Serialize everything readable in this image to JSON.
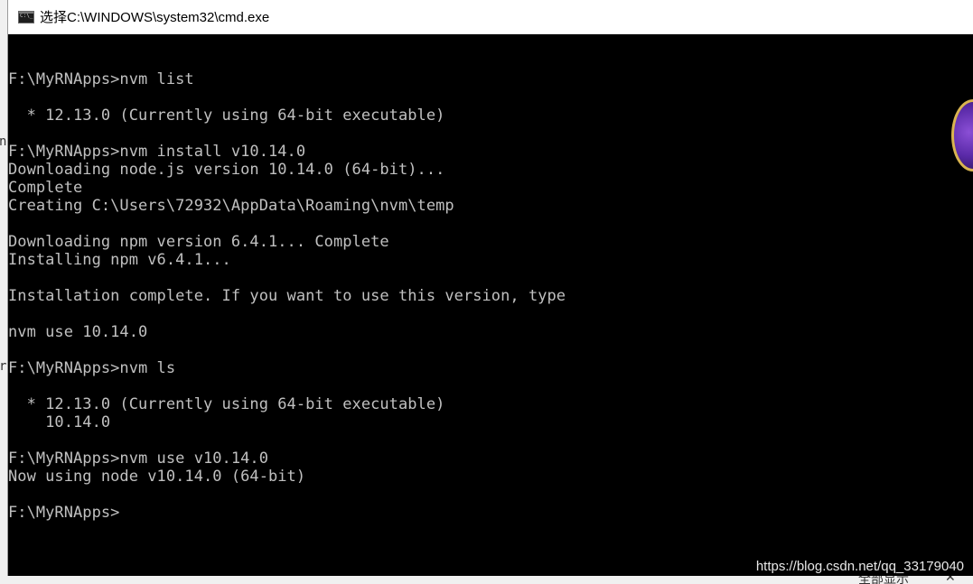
{
  "window": {
    "title": "选择C:\\WINDOWS\\system32\\cmd.exe",
    "icon": "console-icon"
  },
  "console": {
    "text_color": "#c0c0c0",
    "background_color": "#000000",
    "lines": [
      "F:\\MyRNApps>nvm list",
      "",
      "  * 12.13.0 (Currently using 64-bit executable)",
      "",
      "F:\\MyRNApps>nvm install v10.14.0",
      "Downloading node.js version 10.14.0 (64-bit)...",
      "Complete",
      "Creating C:\\Users\\72932\\AppData\\Roaming\\nvm\\temp",
      "",
      "Downloading npm version 6.4.1... Complete",
      "Installing npm v6.4.1...",
      "",
      "Installation complete. If you want to use this version, type",
      "",
      "nvm use 10.14.0",
      "",
      "F:\\MyRNApps>nvm ls",
      "",
      "  * 12.13.0 (Currently using 64-bit executable)",
      "    10.14.0",
      "",
      "F:\\MyRNApps>nvm use v10.14.0",
      "Now using node v10.14.0 (64-bit)",
      "",
      "F:\\MyRNApps>"
    ]
  },
  "background": {
    "left_fragment_1": "n",
    "left_fragment_2": "r",
    "bottom_fragment": "全部显示",
    "bottom_close": "✕"
  },
  "watermark": "https://blog.csdn.net/qq_33179040"
}
